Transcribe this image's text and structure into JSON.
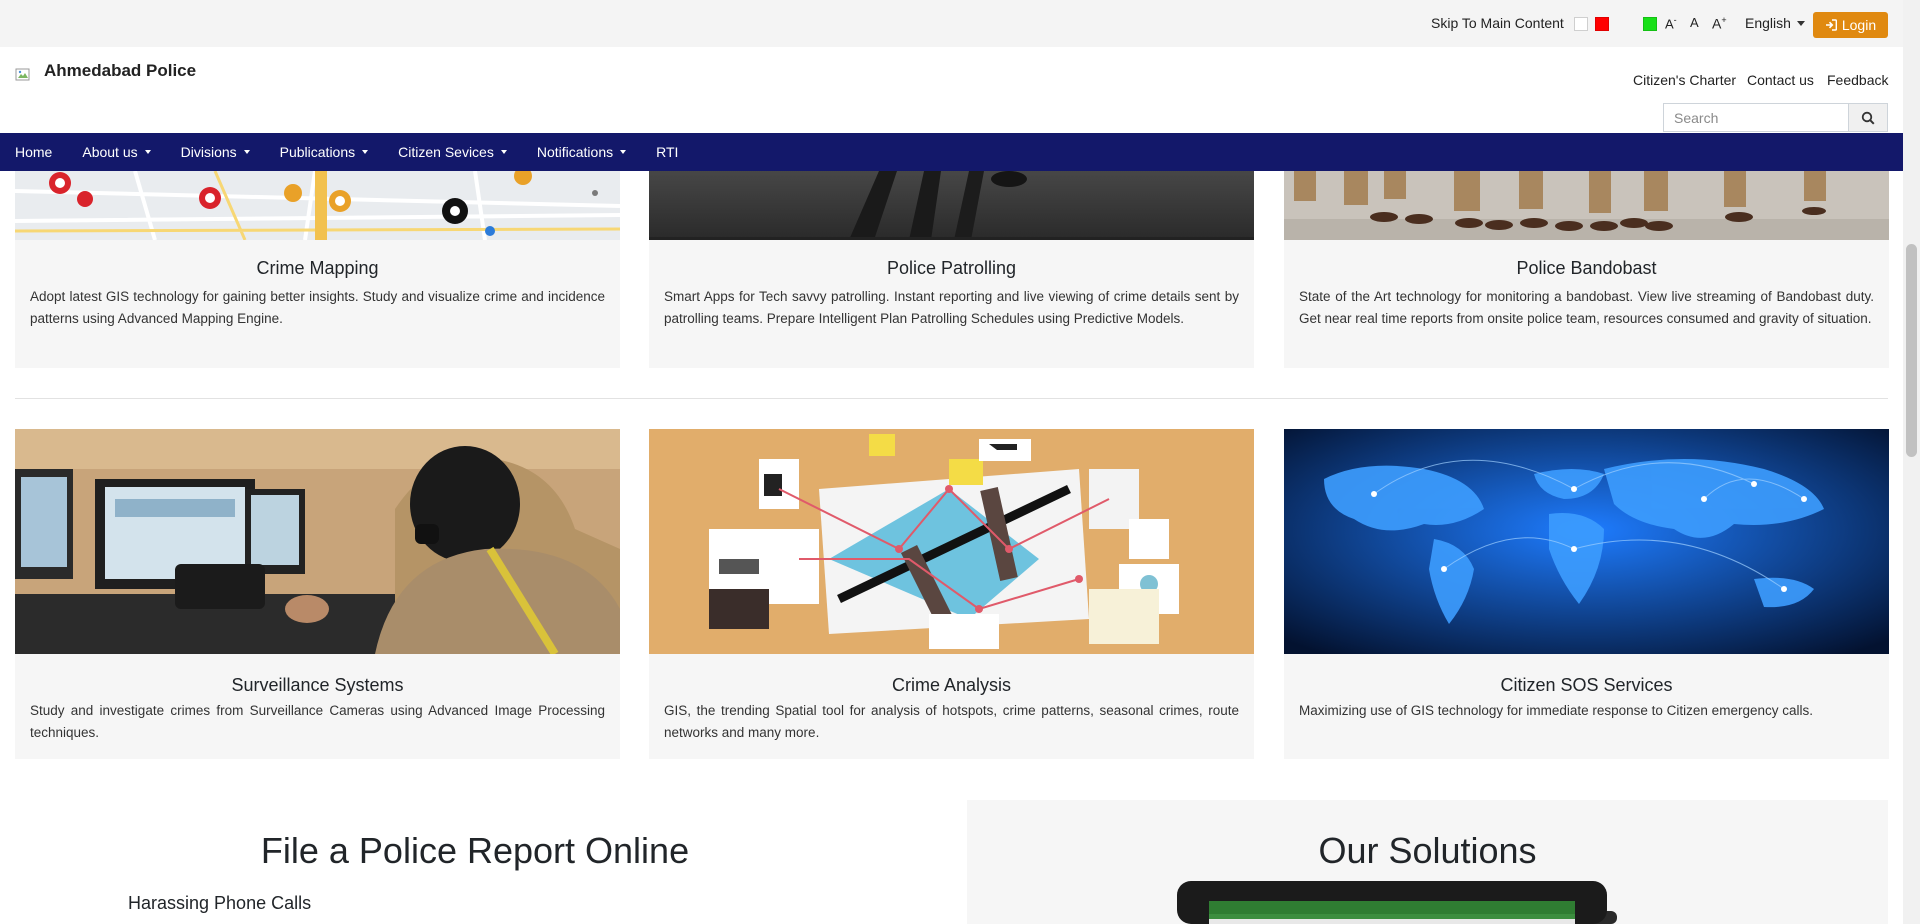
{
  "topbar": {
    "skip_link": "Skip To Main Content",
    "contrast_white": "#ffffff",
    "contrast_red": "#ff0000",
    "contrast_green": "#18e018",
    "font_decrease": "A",
    "font_decrease_sup": "-",
    "font_normal": "A",
    "font_increase": "A",
    "font_increase_sup": "+",
    "language": "English",
    "login_label": "Login",
    "login_color": "#e08910"
  },
  "header": {
    "brand": "Ahmedabad Police",
    "links": {
      "charter": "Citizen's Charter",
      "contact": "Contact us",
      "feedback": "Feedback"
    },
    "search_placeholder": "Search"
  },
  "nav": {
    "color": "#13186a",
    "items": [
      {
        "label": "Home",
        "dropdown": false
      },
      {
        "label": "About us",
        "dropdown": true
      },
      {
        "label": "Divisions",
        "dropdown": true
      },
      {
        "label": "Publications",
        "dropdown": true
      },
      {
        "label": "Citizen Sevices",
        "dropdown": true
      },
      {
        "label": "Notifications",
        "dropdown": true
      },
      {
        "label": "RTI",
        "dropdown": false
      }
    ]
  },
  "cards_row1": [
    {
      "title": "Crime Mapping",
      "text": "Adopt latest GIS technology for gaining better insights. Study and visualize crime and incidence patterns using Advanced Mapping Engine."
    },
    {
      "title": "Police Patrolling",
      "text": "Smart Apps for Tech savvy patrolling. Instant reporting and live viewing of crime details sent by patrolling teams. Prepare Intelligent Plan Patrolling Schedules using Predictive Models."
    },
    {
      "title": "Police Bandobast",
      "text": "State of the Art technology for monitoring a bandobast. View live streaming of Bandobast duty. Get near real time reports from onsite police team, resources consumed and gravity of situation."
    }
  ],
  "cards_row2": [
    {
      "title": "Surveillance Systems",
      "text": "Study and investigate crimes from Surveillance Cameras using Advanced Image Processing techniques."
    },
    {
      "title": "Crime Analysis",
      "text": "GIS, the trending Spatial tool for analysis of hotspots, crime patterns, seasonal crimes, route networks and many more."
    },
    {
      "title": "Citizen SOS Services",
      "text": "Maximizing use of GIS technology for immediate response to Citizen emergency calls."
    }
  ],
  "report": {
    "title": "File a Police Report Online",
    "first_item": "Harassing Phone Calls"
  },
  "solutions": {
    "title": "Our Solutions"
  }
}
